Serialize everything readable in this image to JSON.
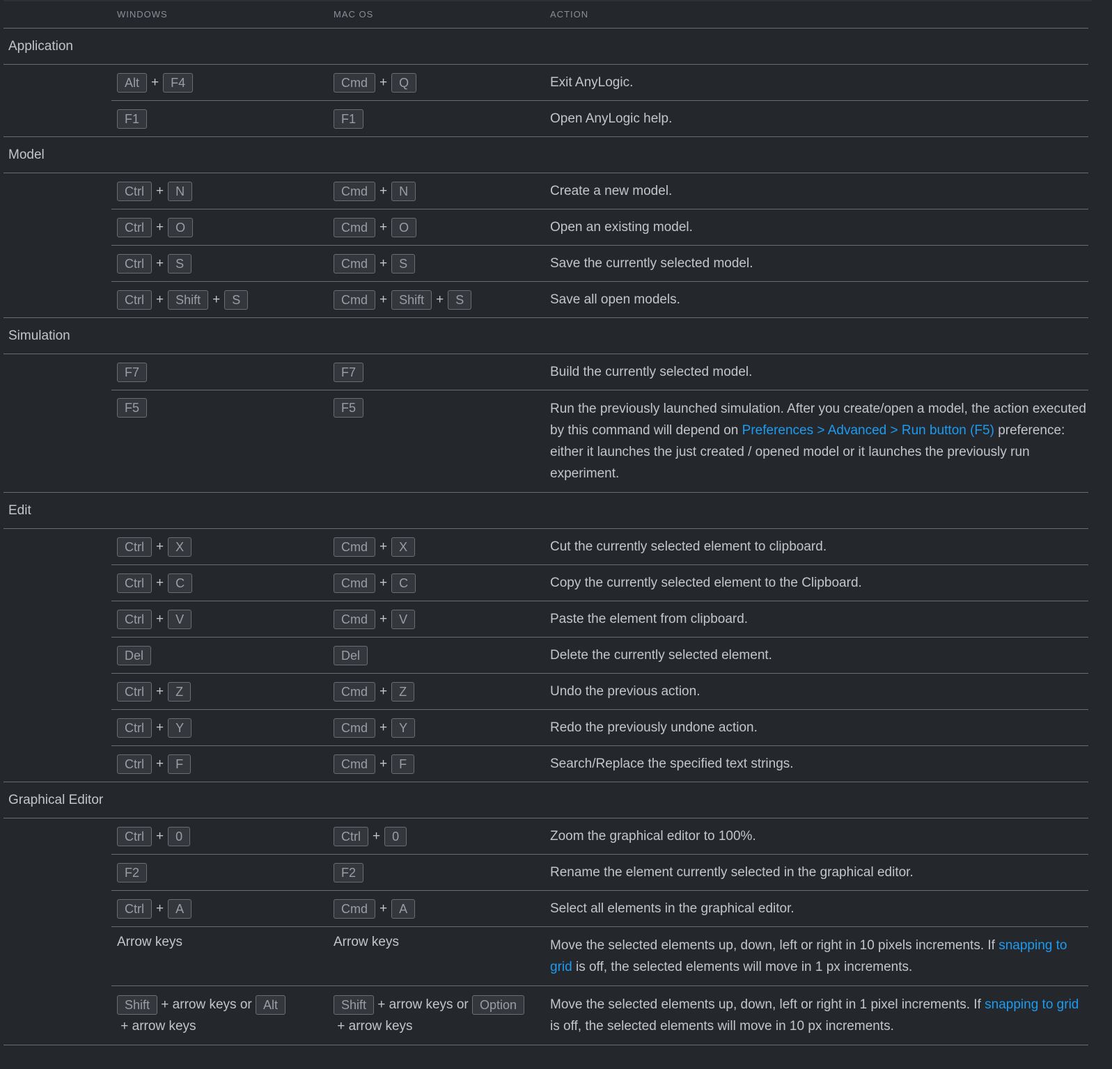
{
  "headers": {
    "windows": "WINDOWS",
    "mac": "MAC OS",
    "action": "ACTION"
  },
  "plus": "+",
  "groups": [
    {
      "title": "Application",
      "rows": [
        {
          "win": [
            "Alt",
            "F4"
          ],
          "mac": [
            "Cmd",
            "Q"
          ],
          "action": "Exit AnyLogic."
        },
        {
          "win": [
            "F1"
          ],
          "mac": [
            "F1"
          ],
          "action": "Open AnyLogic help."
        }
      ]
    },
    {
      "title": "Model",
      "rows": [
        {
          "win": [
            "Ctrl",
            "N"
          ],
          "mac": [
            "Cmd",
            "N"
          ],
          "action": "Create a new model."
        },
        {
          "win": [
            "Ctrl",
            "O"
          ],
          "mac": [
            "Cmd",
            "O"
          ],
          "action": "Open an existing model."
        },
        {
          "win": [
            "Ctrl",
            "S"
          ],
          "mac": [
            "Cmd",
            "S"
          ],
          "action": "Save the currently selected model."
        },
        {
          "win": [
            "Ctrl",
            "Shift",
            "S"
          ],
          "mac": [
            "Cmd",
            "Shift",
            "S"
          ],
          "action": "Save all open models."
        }
      ]
    },
    {
      "title": "Simulation",
      "rows": [
        {
          "win": [
            "F7"
          ],
          "mac": [
            "F7"
          ],
          "action": "Build the currently selected model."
        },
        {
          "win": [
            "F5"
          ],
          "mac": [
            "F5"
          ],
          "tall": true,
          "action_parts": [
            {
              "t": "Run the previously launched simulation. After you create/open a model, the action executed by this command will depend on "
            },
            {
              "t": "Preferences > Advanced > Run button (F5)",
              "link": true
            },
            {
              "t": " preference: either it launches the just created / opened model or it launches the previously run experiment."
            }
          ]
        }
      ]
    },
    {
      "title": "Edit",
      "rows": [
        {
          "win": [
            "Ctrl",
            "X"
          ],
          "mac": [
            "Cmd",
            "X"
          ],
          "action": "Cut the currently selected element to clipboard."
        },
        {
          "win": [
            "Ctrl",
            "C"
          ],
          "mac": [
            "Cmd",
            "C"
          ],
          "action": "Copy the currently selected element to the Clipboard."
        },
        {
          "win": [
            "Ctrl",
            "V"
          ],
          "mac": [
            "Cmd",
            "V"
          ],
          "action": "Paste the element from clipboard."
        },
        {
          "win": [
            "Del"
          ],
          "mac": [
            "Del"
          ],
          "action": "Delete the currently selected element."
        },
        {
          "win": [
            "Ctrl",
            "Z"
          ],
          "mac": [
            "Cmd",
            "Z"
          ],
          "action": "Undo the previous action."
        },
        {
          "win": [
            "Ctrl",
            "Y"
          ],
          "mac": [
            "Cmd",
            "Y"
          ],
          "action": "Redo the previously undone action."
        },
        {
          "win": [
            "Ctrl",
            "F"
          ],
          "mac": [
            "Cmd",
            "F"
          ],
          "action": "Search/Replace the specified text strings."
        }
      ]
    },
    {
      "title": "Graphical Editor",
      "rows": [
        {
          "win": [
            "Ctrl",
            "0"
          ],
          "mac": [
            "Ctrl",
            "0"
          ],
          "action": "Zoom the graphical editor to 100%."
        },
        {
          "win": [
            "F2"
          ],
          "mac": [
            "F2"
          ],
          "action": "Rename the element currently selected in the graphical editor."
        },
        {
          "win": [
            "Ctrl",
            "A"
          ],
          "mac": [
            "Cmd",
            "A"
          ],
          "action": "Select all elements in the graphical editor."
        },
        {
          "win_text": "Arrow keys",
          "mac_text": "Arrow keys",
          "tall": true,
          "action_parts": [
            {
              "t": "Move the selected elements up, down, left or right in 10 pixels increments. If "
            },
            {
              "t": "snapping to grid",
              "link": true
            },
            {
              "t": " is off, the selected elements will move in 1 px increments."
            }
          ]
        },
        {
          "win_mixed": [
            {
              "k": "Shift"
            },
            {
              "t": " + arrow keys or "
            },
            {
              "k": "Alt"
            },
            {
              "t": " + arrow keys"
            }
          ],
          "mac_mixed": [
            {
              "k": "Shift"
            },
            {
              "t": " + arrow keys or "
            },
            {
              "k": "Option"
            },
            {
              "t": " + arrow keys"
            }
          ],
          "tall": true,
          "action_parts": [
            {
              "t": "Move the selected elements up, down, left or right in 1 pixel increments. If "
            },
            {
              "t": "snapping to grid",
              "link": true
            },
            {
              "t": " is off, the selected elements will move in 10 px increments."
            }
          ]
        }
      ]
    }
  ]
}
